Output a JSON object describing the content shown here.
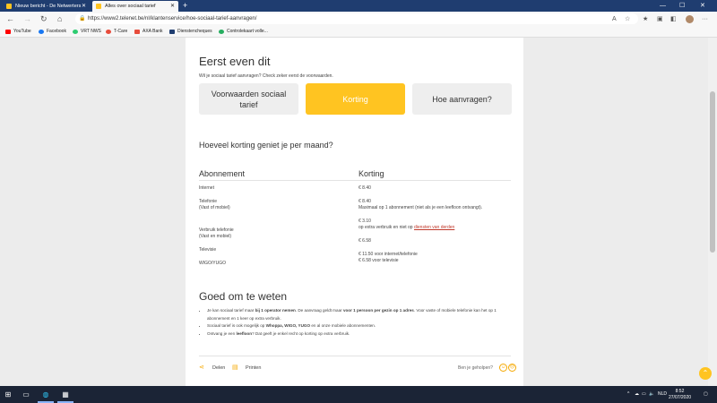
{
  "browser": {
    "tabs": [
      {
        "label": "Nieuw bericht - De Netwerters"
      },
      {
        "label": "Alles over sociaal tarief"
      }
    ],
    "new_tab": "+",
    "window_controls": {
      "minimize": "—",
      "maximize": "☐",
      "close": "✕"
    },
    "url": "https://www2.telenet.be/nl/klantenservice/hoe-sociaal-tarief-aanvragen/",
    "bookmarks": [
      {
        "label": "YouTube",
        "color": "#ff0000"
      },
      {
        "label": "Facebook",
        "color": "#1877f2"
      },
      {
        "label": "VRT NWS",
        "color": "#2ecc71"
      },
      {
        "label": "T-Care",
        "color": "#e74c3c"
      },
      {
        "label": "AXA Bank",
        "color": "#e74c3c"
      },
      {
        "label": "Dienstencheques",
        "color": "#1f3d70"
      },
      {
        "label": "Controlekaart volle...",
        "color": "#27ae60"
      }
    ]
  },
  "page": {
    "title": "Eerst even dit",
    "intro": "Wil je sociaal tarief aanvragen? Check zeker eerst de voorwaarden.",
    "tabs": [
      {
        "label": "Voorwaarden sociaal tarief"
      },
      {
        "label": "Korting"
      },
      {
        "label": "Hoe aanvragen?"
      }
    ],
    "discount_heading": "Hoeveel korting geniet je per maand?",
    "table": {
      "col1": "Abonnement",
      "col2": "Korting",
      "rows": [
        {
          "sub": "Internet",
          "disc": "€ 8.40"
        },
        {
          "sub": "Telefonie\n(Vast of mobiel)",
          "disc": "€ 8.40\nMaximaal op 1 abonnement (niet als je een leefloon ontvangt)."
        },
        {
          "sub": "Verbruik telefonie\n(Vast en mobiel)",
          "disc": "€ 3.10\nop extra verbruik en niet op ",
          "link": "diensten van derden"
        },
        {
          "sub": "Televisie",
          "disc": "€ 6.58"
        },
        {
          "sub": "WIGO/YUGO",
          "disc": "€ 11.50 voor internet/telefonie\n€ 6.58 voor televisie"
        }
      ]
    },
    "good_to_know": {
      "title": "Goed om te weten",
      "bullets": [
        {
          "pre": "Je kan sociaal tarief maar ",
          "b1": "bij 1 operator nemen",
          "mid": ". De aanvraag geldt maar ",
          "b2": "voor 1 persoon per gezin op 1 adres",
          "post": ". Voor vaste of mobiele telefonie kan het op 1 abonnement en 1 keer op extra verbruik."
        },
        {
          "pre": "Sociaal tarief is ook mogelijk op ",
          "b1": "Whoppa, WIGO, YUGO",
          "mid": " en al onze mobiele abonnementen.",
          "b2": "",
          "post": ""
        },
        {
          "pre": "Ontvang je een ",
          "b1": "leefloon",
          "mid": "? Dat geeft je enkel recht op korting op extra verbruik.",
          "b2": "",
          "post": ""
        }
      ]
    },
    "share_label": "Delen",
    "print_label": "Printen",
    "helped_label": "Ben je geholpen?"
  },
  "taskbar": {
    "lang": "NLD",
    "time": "8:52",
    "date": "27/07/2020"
  },
  "colors": {
    "accent": "#ffc421",
    "titlebar": "#1f3d70",
    "taskbar": "#1b2436"
  }
}
